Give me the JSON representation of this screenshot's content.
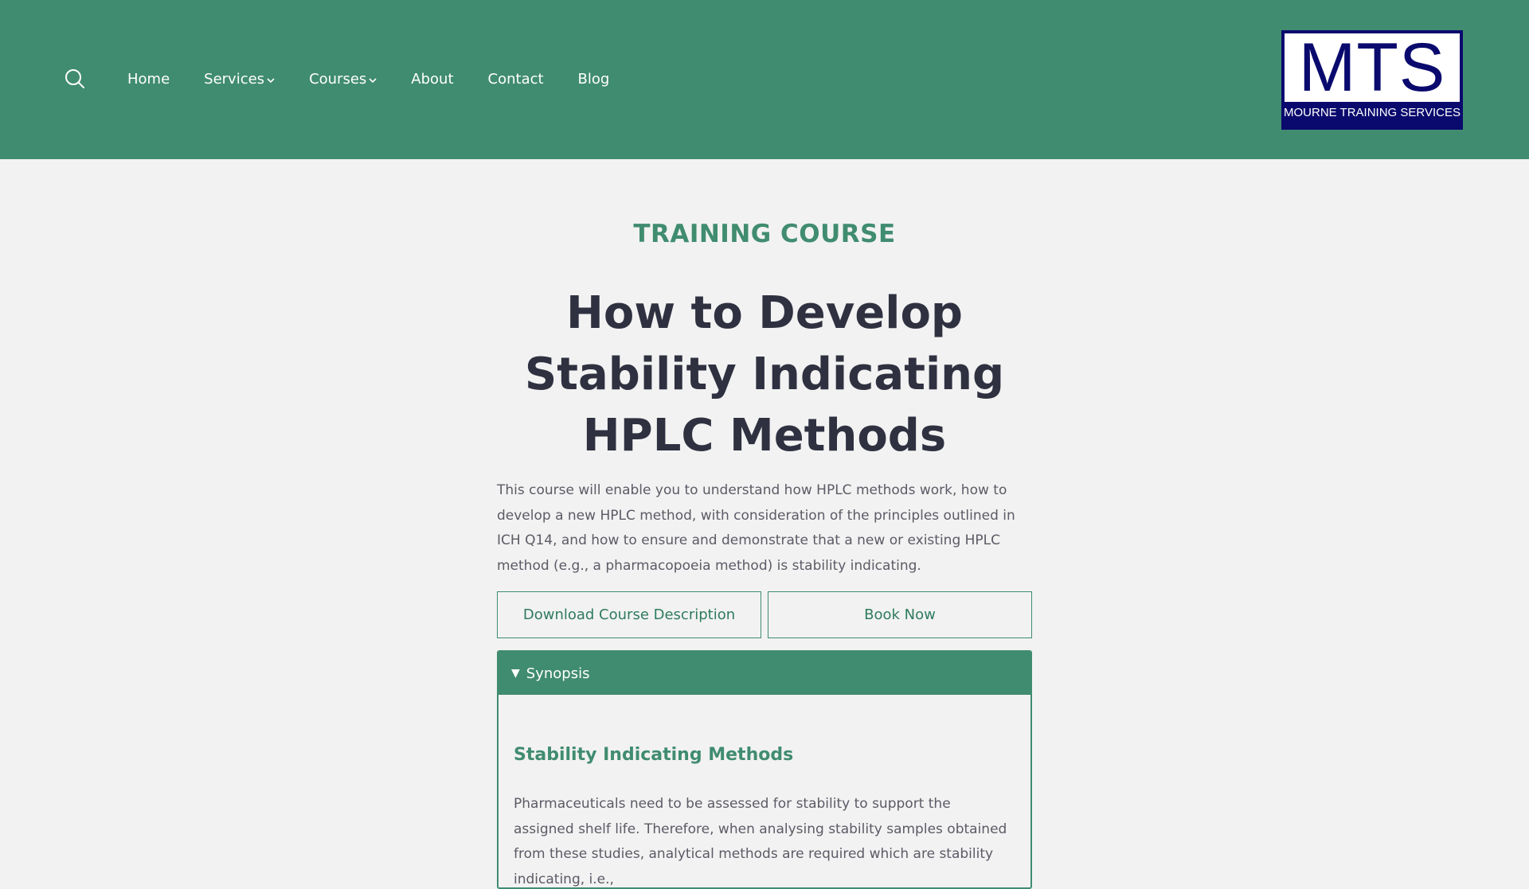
{
  "header": {
    "search_icon": "search-icon",
    "nav": [
      {
        "label": "Home",
        "has_dropdown": false
      },
      {
        "label": "Services",
        "has_dropdown": true
      },
      {
        "label": "Courses",
        "has_dropdown": true
      },
      {
        "label": "About",
        "has_dropdown": false
      },
      {
        "label": "Contact",
        "has_dropdown": false
      },
      {
        "label": "Blog",
        "has_dropdown": false
      }
    ],
    "logo": {
      "mark": "MTS",
      "tagline": "MOURNE TRAINING SERVICES"
    }
  },
  "main": {
    "eyebrow": "TRAINING COURSE",
    "title": "How to Develop Stability Indicating HPLC Methods",
    "intro": "This course will enable you to understand how HPLC methods work, how to develop a new HPLC method, with consideration of the principles outlined in ICH Q14, and how to ensure and demonstrate that a new or existing HPLC method (e.g., a pharmacopoeia method) is stability indicating.",
    "buttons": {
      "download": "Download Course Description",
      "book": "Book Now"
    },
    "accordion": {
      "arrow": "▼",
      "label": "Synopsis",
      "heading": "Stability Indicating Methods",
      "text": "Pharmaceuticals need to be assessed for stability to support the assigned shelf life. Therefore, when analysing stability samples obtained from these studies, analytical methods are required which are stability indicating, i.e.,"
    }
  },
  "colors": {
    "brand_green": "#408c70",
    "title_dark": "#2f3141",
    "body_text": "#5b5b66",
    "logo_navy": "#0a0a6e",
    "page_bg": "#f2f2f2"
  }
}
